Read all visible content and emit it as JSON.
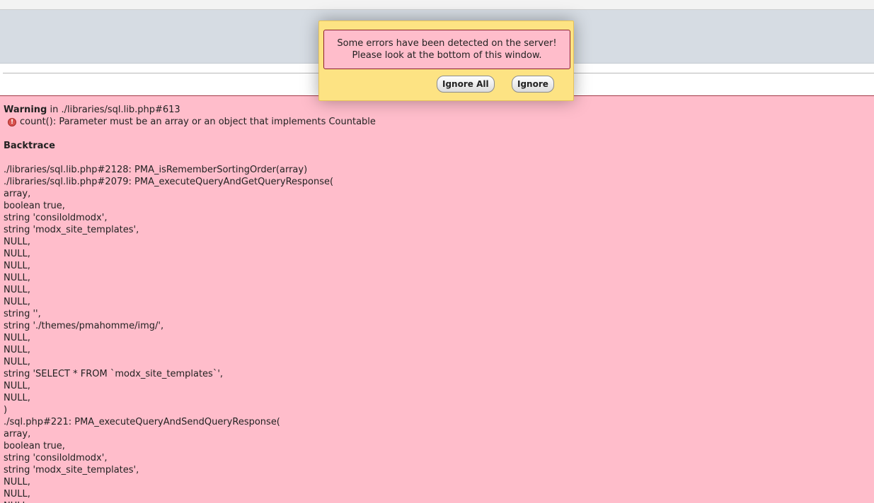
{
  "dialog": {
    "message_line1": "Some errors have been detected on the server!",
    "message_line2": "Please look at the bottom of this window.",
    "ignore_all_label": "Ignore All",
    "ignore_label": "Ignore"
  },
  "error": {
    "warning_label": "Warning",
    "warning_location": " in ./libraries/sql.lib.php#613",
    "icon": "error-icon",
    "message": "count(): Parameter must be an array or an object that implements Countable",
    "backtrace_label": "Backtrace",
    "backtrace_lines": [
      "./libraries/sql.lib.php#2128: PMA_isRememberSortingOrder(array)",
      "./libraries/sql.lib.php#2079: PMA_executeQueryAndGetQueryResponse(",
      "array,",
      "boolean true,",
      "string 'consiloldmodx',",
      "string 'modx_site_templates',",
      "NULL,",
      "NULL,",
      "NULL,",
      "NULL,",
      "NULL,",
      "NULL,",
      "string '',",
      "string './themes/pmahomme/img/',",
      "NULL,",
      "NULL,",
      "NULL,",
      "string 'SELECT * FROM `modx_site_templates`',",
      "NULL,",
      "NULL,",
      ")",
      "./sql.php#221: PMA_executeQueryAndSendQueryResponse(",
      "array,",
      "boolean true,",
      "string 'consiloldmodx',",
      "string 'modx_site_templates',",
      "NULL,",
      "NULL,",
      "NULL,"
    ]
  },
  "colors": {
    "error_background": "#ffbdcb",
    "dialog_background": "#fde383",
    "header_band": "#d6dce3"
  }
}
